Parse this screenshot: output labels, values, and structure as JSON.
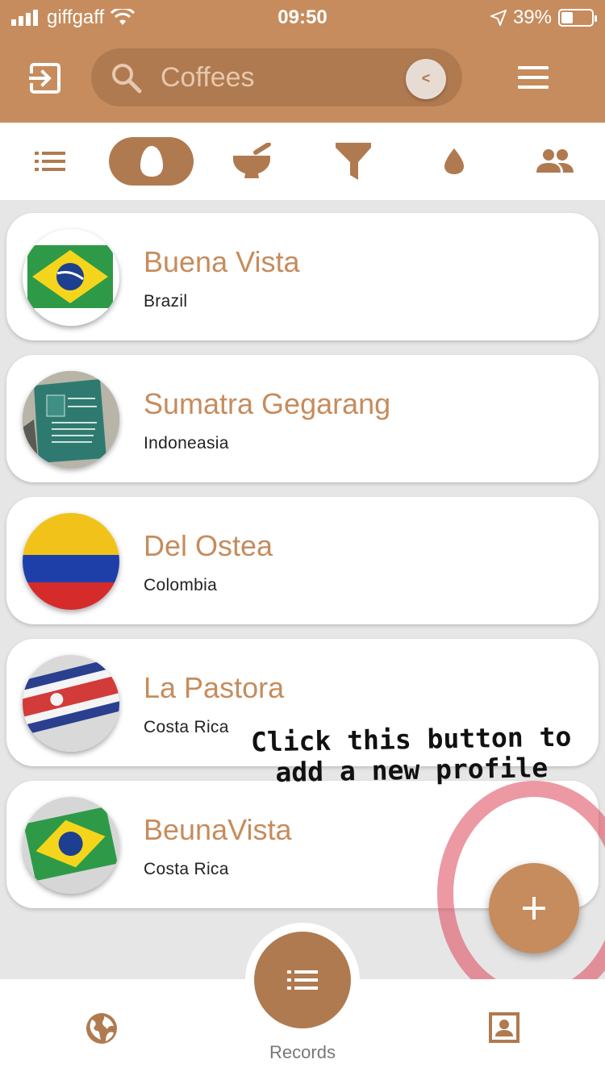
{
  "status_bar": {
    "carrier": "giffgaff",
    "time": "09:50",
    "battery_percent": "39%"
  },
  "header": {
    "search_placeholder": "Coffees",
    "collapse_label": "<"
  },
  "filter_tabs": [
    {
      "icon": "list-icon",
      "active": false
    },
    {
      "icon": "bean-icon",
      "active": true
    },
    {
      "icon": "grinder-icon",
      "active": false
    },
    {
      "icon": "filter-icon",
      "active": false
    },
    {
      "icon": "drop-icon",
      "active": false
    },
    {
      "icon": "people-icon",
      "active": false
    }
  ],
  "coffees": [
    {
      "name": "Buena Vista",
      "origin": "Brazil",
      "image": "brazil-flag"
    },
    {
      "name": "Sumatra Gegarang",
      "origin": "Indoneasia",
      "image": "coffee-bag-photo"
    },
    {
      "name": "Del Ostea",
      "origin": "Colombia",
      "image": "colombia-flag"
    },
    {
      "name": "La Pastora",
      "origin": "Costa Rica",
      "image": "costa-rica-flag-photo"
    },
    {
      "name": "BeunaVista",
      "origin": "Costa Rica",
      "image": "brazil-flag-photo"
    }
  ],
  "annotation": {
    "line1": "Click this button to",
    "line2": "add a new profile"
  },
  "fab": {
    "icon": "plus-icon"
  },
  "bottom_nav": {
    "center_label": "Records",
    "left_icon": "globe-icon",
    "center_icon": "list-icon",
    "right_icon": "contact-icon"
  },
  "colors": {
    "brand": "#c68c5d",
    "brand_dark": "#b07a50",
    "annotation_ring": "#dc465a"
  }
}
